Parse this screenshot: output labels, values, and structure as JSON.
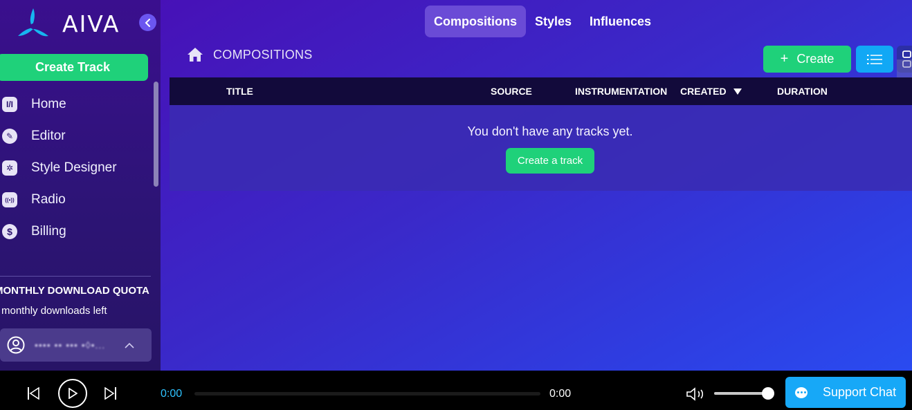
{
  "app": {
    "name": "AIVA"
  },
  "sidebar": {
    "create_track_label": "Create Track",
    "items": [
      {
        "label": "Home",
        "icon": "home-logo-icon",
        "glyph": "I/I"
      },
      {
        "label": "Editor",
        "icon": "pencil-icon",
        "glyph": "✎"
      },
      {
        "label": "Style Designer",
        "icon": "style-designer-icon",
        "glyph": "✲"
      },
      {
        "label": "Radio",
        "icon": "radio-icon",
        "glyph": "((•))"
      },
      {
        "label": "Billing",
        "icon": "dollar-icon",
        "glyph": "$"
      }
    ],
    "quota_title": "MONTHLY DOWNLOAD QUOTA",
    "quota_sub": "monthly downloads left",
    "user_name": "•••• •• ••• •◊•..."
  },
  "tabs": [
    {
      "label": "Compositions",
      "active": true
    },
    {
      "label": "Styles",
      "active": false
    },
    {
      "label": "Influences",
      "active": false
    }
  ],
  "breadcrumb": {
    "label": "COMPOSITIONS"
  },
  "actions": {
    "create_label": "Create"
  },
  "table": {
    "columns": [
      "TITLE",
      "SOURCE",
      "INSTRUMENTATION",
      "CREATED",
      "DURATION"
    ],
    "sort_column": "CREATED",
    "empty_message": "You don't have any tracks yet.",
    "empty_button_label": "Create a track"
  },
  "player": {
    "time_current": "0:00",
    "time_total": "0:00",
    "progress": 0,
    "volume": 1.0
  },
  "support": {
    "label": "Support Chat"
  },
  "colors": {
    "accent_green": "#1fd17a",
    "accent_blue": "#17a8f7",
    "time_cyan": "#2ec3ff"
  }
}
